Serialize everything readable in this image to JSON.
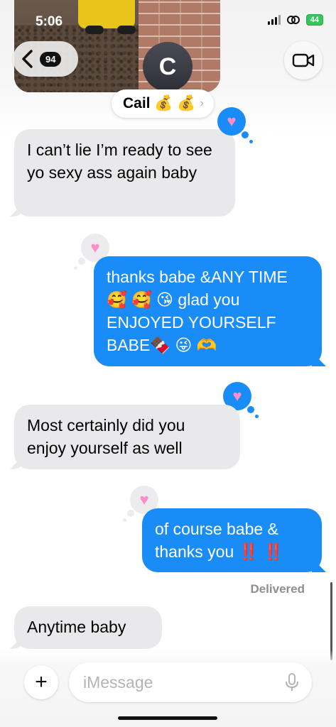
{
  "status_bar": {
    "time": "5:06",
    "battery": "44"
  },
  "header": {
    "back_count": "94",
    "avatar_initial": "C",
    "contact_name": "Cail 💰 💰",
    "name_chevron": "›"
  },
  "messages": [
    {
      "from": "received",
      "text": "I can’t lie I’m ready to see yo sexy ass again baby",
      "reaction": "heart"
    },
    {
      "from": "sent",
      "text": "thanks babe &ANY TIME 🥰 🥰 😘 glad you ENJOYED YOURSELF BABE🍫 😜 🫶",
      "reaction": "heart"
    },
    {
      "from": "received",
      "text": "Most certainly did you enjoy yourself as well",
      "reaction": "heart"
    },
    {
      "from": "sent",
      "text": "of course babe & thanks you ‼️ ‼️",
      "reaction": "heart"
    },
    {
      "from": "received",
      "text": "Anytime baby"
    }
  ],
  "delivered_label": "Delivered",
  "composer": {
    "placeholder": "iMessage",
    "plus": "+"
  },
  "icons": {
    "back": "chevron-left-icon",
    "video": "video-camera-icon",
    "reaction": "heart-icon",
    "mic": "microphone-icon"
  },
  "colors": {
    "sent_bubble": "#1a8cf8",
    "received_bubble": "#e9e9eb",
    "heart": "#ff8dc8",
    "battery": "#34c759"
  }
}
